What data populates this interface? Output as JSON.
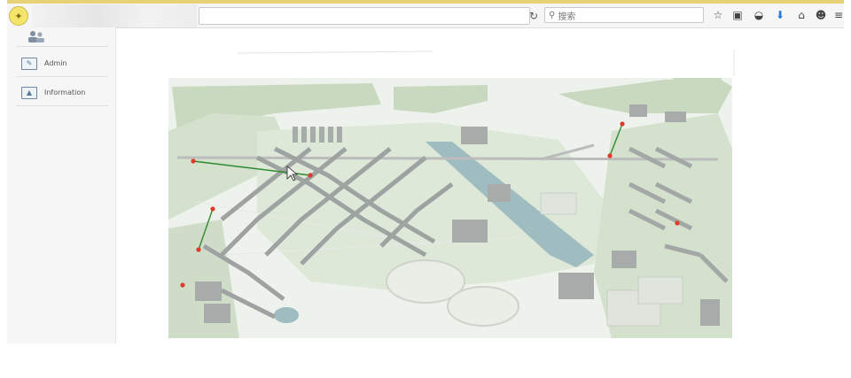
{
  "toolbar": {
    "search_placeholder": "搜索",
    "icons": [
      "home-icon",
      "reload-icon",
      "search-icon",
      "star-icon",
      "clipboard-icon",
      "pocket-icon",
      "download-icon",
      "house-icon",
      "smiley-icon",
      "menu-icon"
    ]
  },
  "sidebar": {
    "items": [
      {
        "label": "Admin",
        "icon": "edit-icon"
      },
      {
        "label": "Information",
        "icon": "image-icon"
      }
    ]
  },
  "colors": {
    "map_green": "#c8d9c0",
    "building_gray": "#9ea3a2",
    "water": "#9fbcc1",
    "path_line": "#2f8a2f",
    "marker": "#e03a2a"
  }
}
